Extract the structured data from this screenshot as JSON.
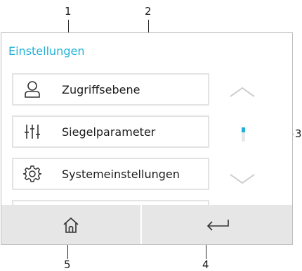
{
  "screen": {
    "title": "Einstellungen"
  },
  "menu": {
    "items": [
      {
        "label": "Zugriffsebene",
        "icon": "user-icon"
      },
      {
        "label": "Siegelparameter",
        "icon": "sliders-icon"
      },
      {
        "label": "Systemeinstellungen",
        "icon": "gear-icon"
      }
    ]
  },
  "navigation": {
    "scroll_up_icon": "chevron-up-icon",
    "scroll_down_icon": "chevron-down-icon",
    "home_icon": "home-icon",
    "back_icon": "return-icon"
  },
  "callouts": {
    "c1": "1",
    "c2": "2",
    "c3": "3",
    "c4": "4",
    "c5": "5"
  },
  "colors": {
    "accent": "#1fb1d8",
    "bottom_bar": "#e6e6e6",
    "item_border": "#e3e3e3",
    "chevron": "#cfcfcf"
  }
}
